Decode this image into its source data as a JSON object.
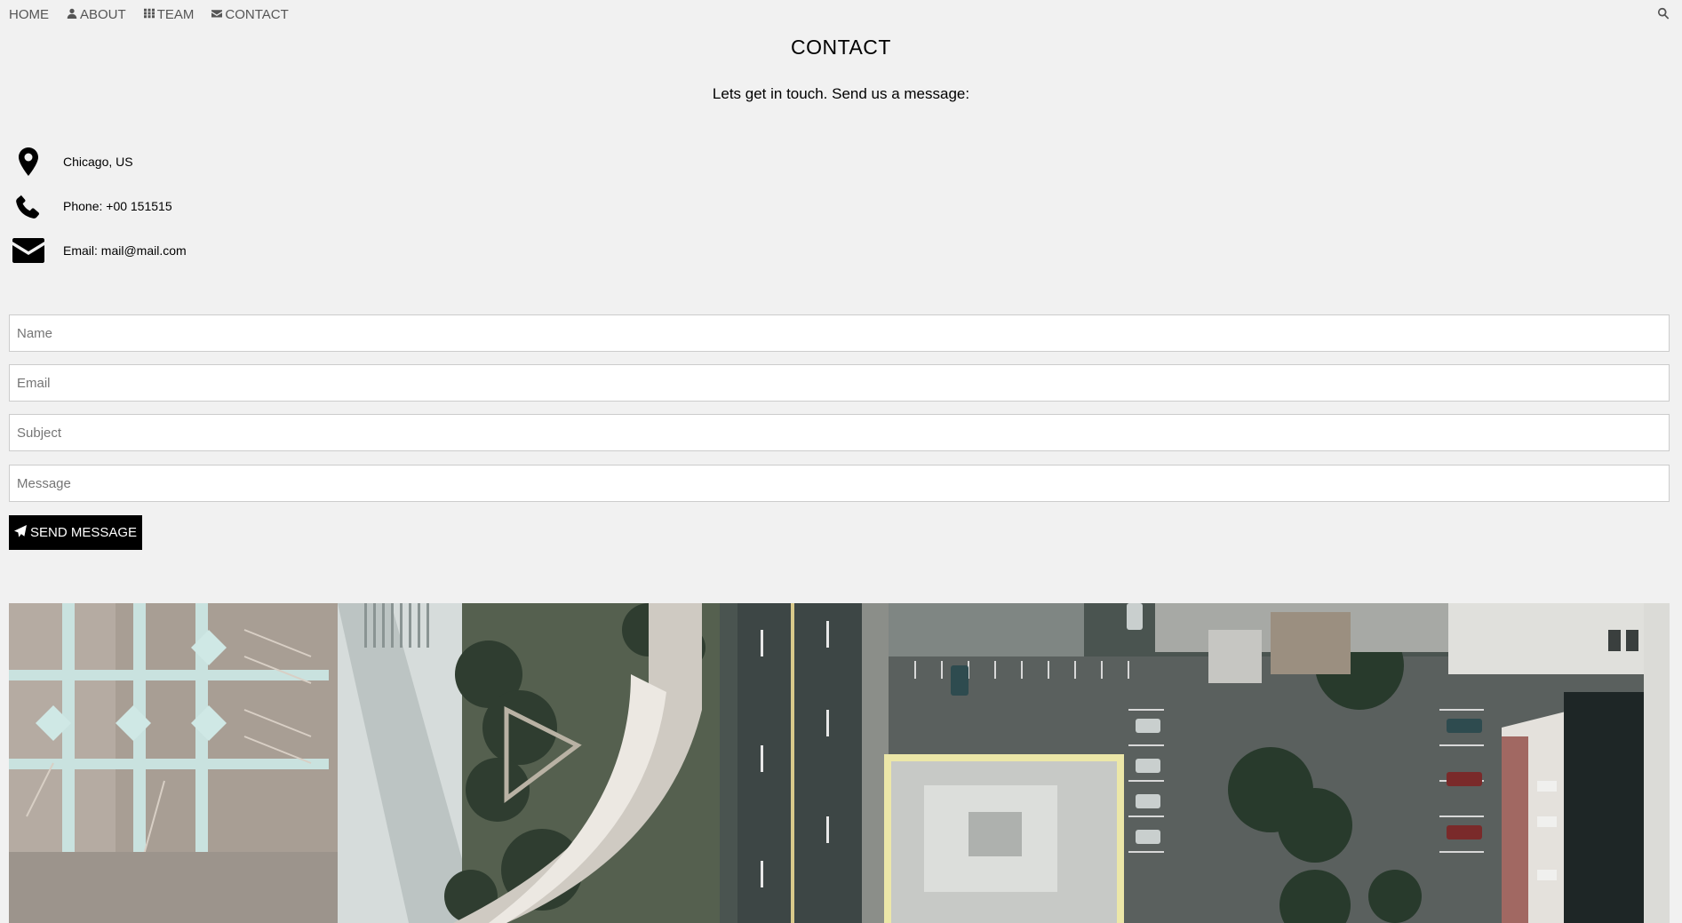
{
  "nav": {
    "items": [
      {
        "label": "HOME",
        "icon": ""
      },
      {
        "label": "ABOUT",
        "icon": "user-icon"
      },
      {
        "label": "TEAM",
        "icon": "grid-icon"
      },
      {
        "label": "CONTACT",
        "icon": "envelope-icon"
      }
    ],
    "search_icon": "search-icon"
  },
  "contact": {
    "title": "CONTACT",
    "subtitle": "Lets get in touch. Send us a message:",
    "info": [
      {
        "icon": "map-marker-icon",
        "text": "Chicago, US"
      },
      {
        "icon": "phone-icon",
        "text": "Phone: +00 151515"
      },
      {
        "icon": "envelope-icon",
        "text": "Email: mail@mail.com"
      }
    ]
  },
  "form": {
    "name_placeholder": "Name",
    "email_placeholder": "Email",
    "subject_placeholder": "Subject",
    "message_placeholder": "Message",
    "submit_label": "SEND MESSAGE",
    "submit_icon": "paper-plane-icon"
  },
  "hero": {
    "image": "aerial city view"
  },
  "colors": {
    "background": "#f1f1f1",
    "button": "#000000",
    "nav_text": "#555555"
  }
}
